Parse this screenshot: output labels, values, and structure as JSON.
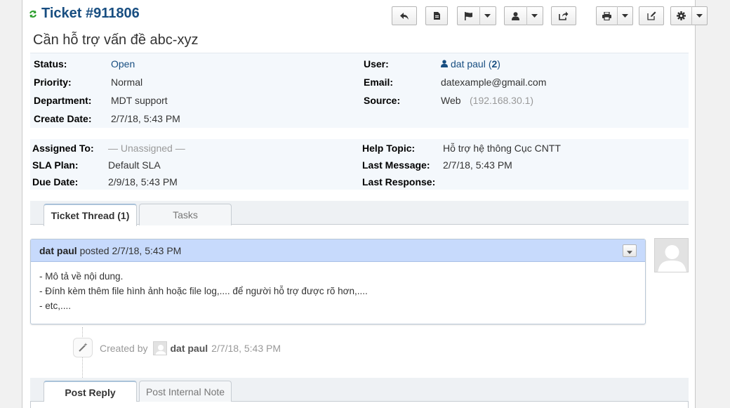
{
  "header": {
    "ticket_number": "Ticket #911806",
    "subject": "Cần hỗ trợ vấn đề abc-xyz"
  },
  "toolbar": {
    "icons": [
      "reply-icon",
      "note-icon",
      "flag-icon",
      "user-icon",
      "share-icon",
      "print-icon",
      "edit-icon",
      "gear-icon"
    ]
  },
  "info": {
    "status_label": "Status:",
    "status_value": "Open",
    "priority_label": "Priority:",
    "priority_value": "Normal",
    "department_label": "Department:",
    "department_value": "MDT support",
    "create_date_label": "Create Date:",
    "create_date_value": "2/7/18, 5:43 PM",
    "user_label": "User:",
    "user_name": "dat paul",
    "user_count_open": "(",
    "user_count": "2",
    "user_count_close": ")",
    "email_label": "Email:",
    "email_value": "datexample@gmail.com",
    "source_label": "Source:",
    "source_value": "Web",
    "source_ip": "(192.168.30.1)"
  },
  "assignment": {
    "assigned_label": "Assigned To:",
    "assigned_value": "— Unassigned —",
    "sla_label": "SLA Plan:",
    "sla_value": "Default SLA",
    "due_label": "Due Date:",
    "due_value": "2/9/18, 5:43 PM",
    "topic_label": "Help Topic:",
    "topic_value": "Hỗ trợ hệ thông Cục CNTT",
    "last_message_label": "Last Message:",
    "last_message_value": "2/7/18, 5:43 PM",
    "last_response_label": "Last Response:"
  },
  "tabs": {
    "thread": "Ticket Thread (1)",
    "tasks": "Tasks"
  },
  "thread": {
    "author": "dat paul",
    "posted": "posted 2/7/18, 5:43 PM",
    "lines": [
      "- Mô tả về nội dung.",
      "- Đính kèm thêm file hình ảnh hoặc file log,.... để người hỗ trợ được rõ hơn,....",
      "- etc,...."
    ]
  },
  "event": {
    "created_by": "Created by",
    "author": "dat paul",
    "time": "2/7/18, 5:43 PM"
  },
  "reply_tabs": {
    "post_reply": "Post Reply",
    "internal_note": "Post Internal Note"
  },
  "colors": {
    "title": "#184e81",
    "thread_header": "#c7dafc",
    "info_bg": "#f4f8fc"
  }
}
